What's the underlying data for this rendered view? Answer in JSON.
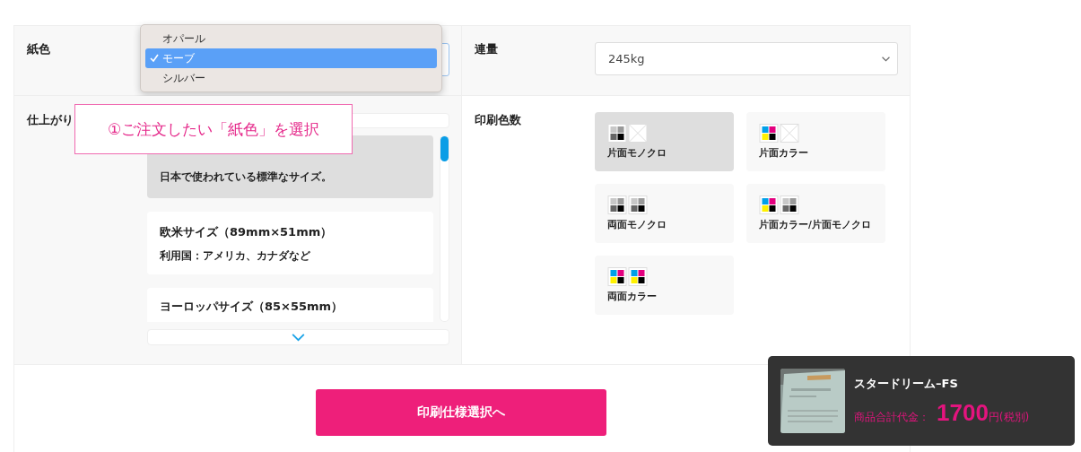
{
  "paper_color": {
    "label": "紙色",
    "options": [
      {
        "label": "オパール",
        "selected": false
      },
      {
        "label": "モーブ",
        "selected": true
      },
      {
        "label": "シルバー",
        "selected": false
      }
    ]
  },
  "weight": {
    "label": "連量",
    "value": "245kg"
  },
  "finish": {
    "label": "仕上がり",
    "items": [
      {
        "note": "日本で使われている標準なサイズ。",
        "selected": true
      },
      {
        "title": "欧米サイズ（89mm×51mm）",
        "note": "利用国：アメリカ、カナダなど",
        "selected": false
      },
      {
        "title": "ヨーロッパサイズ（85×55mm）",
        "selected": false
      }
    ]
  },
  "print_colors": {
    "label": "印刷色数",
    "options": [
      {
        "label": "片面モノクロ",
        "sheets": [
          {
            "kind": "mono"
          },
          {
            "kind": "blank"
          }
        ],
        "selected": true
      },
      {
        "label": "片面カラー",
        "sheets": [
          {
            "kind": "color"
          },
          {
            "kind": "blank"
          }
        ],
        "selected": false
      },
      {
        "label": "両面モノクロ",
        "sheets": [
          {
            "kind": "mono"
          },
          {
            "kind": "mono"
          }
        ],
        "selected": false
      },
      {
        "label": "片面カラー/片面モノクロ",
        "sheets": [
          {
            "kind": "color"
          },
          {
            "kind": "mono"
          }
        ],
        "selected": false
      },
      {
        "label": "両面カラー",
        "sheets": [
          {
            "kind": "color"
          },
          {
            "kind": "color"
          }
        ],
        "selected": false
      }
    ]
  },
  "callout": "①ご注文したい「紙色」を選択",
  "next_button": "印刷仕様選択へ",
  "summary": {
    "product": "スタードリーム–FS",
    "price_label": "商品合計代金：",
    "price": "1700",
    "unit": "円(税別)"
  }
}
